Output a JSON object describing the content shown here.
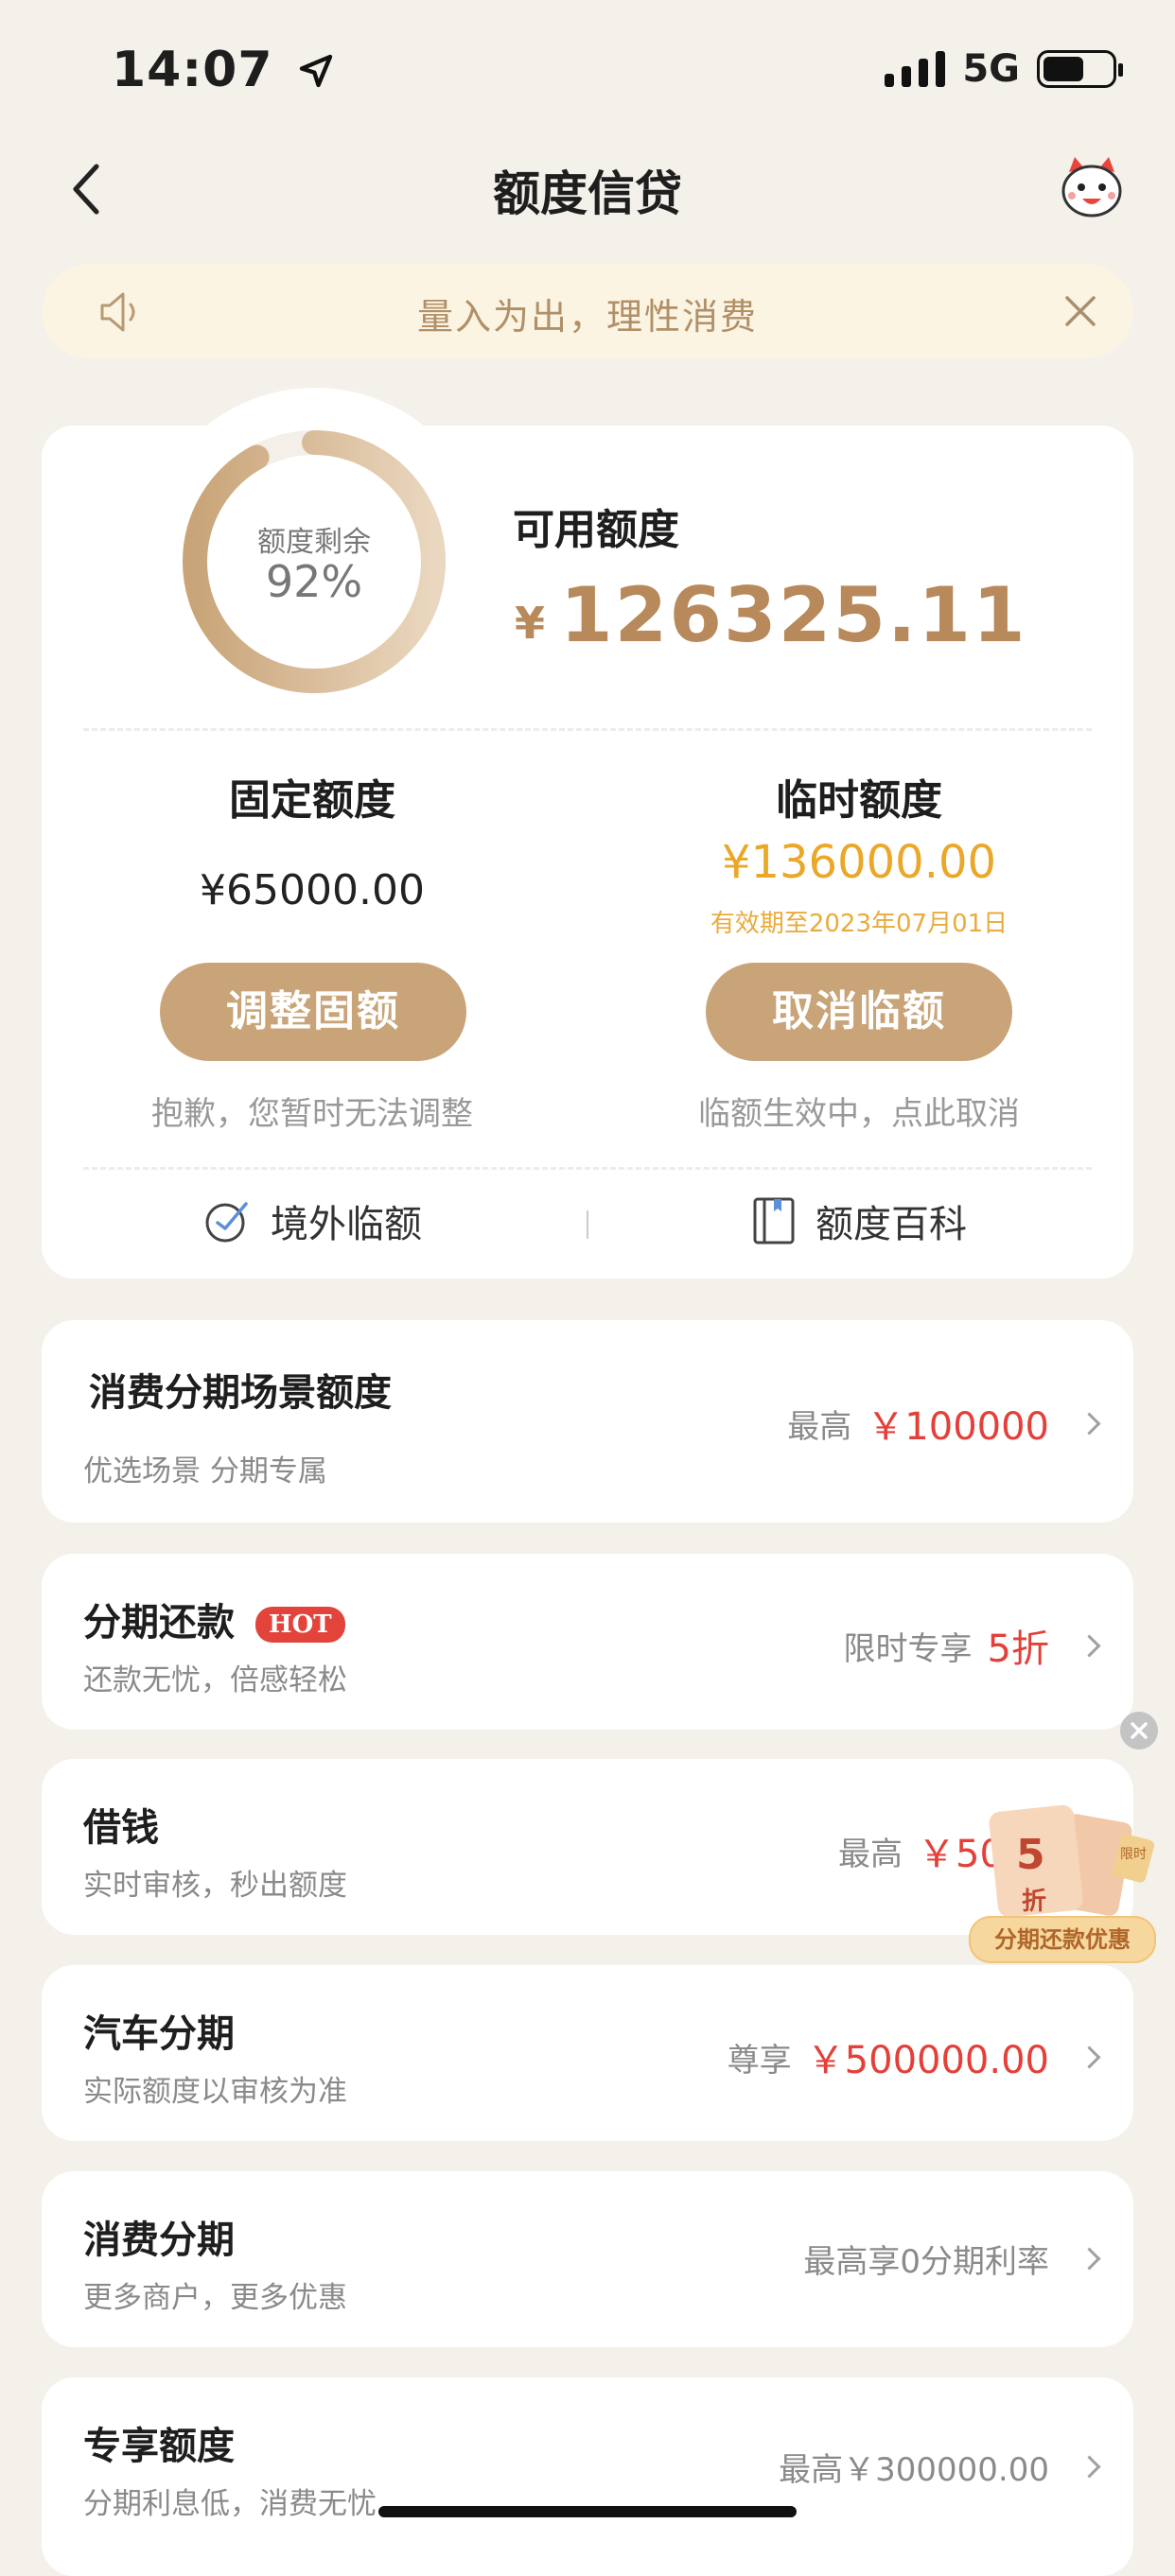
{
  "status_bar": {
    "time": "14:07",
    "network": "5G"
  },
  "nav": {
    "title": "额度信贷"
  },
  "notice": {
    "text": "量入为出，理性消费"
  },
  "credit": {
    "ring_label": "额度剩余",
    "ring_percent": "92%",
    "ring_fraction": 0.92,
    "available_label": "可用额度",
    "available_currency": "¥",
    "available_amount": "126325.11",
    "fixed_title": "固定额度",
    "fixed_amount": "¥65000.00",
    "temp_title": "临时额度",
    "temp_amount": "¥136000.00",
    "temp_valid": "有效期至2023年07月01日",
    "adjust_button": "调整固额",
    "adjust_note": "抱歉，您暂时无法调整",
    "cancel_button": "取消临额",
    "cancel_note": "临额生效中，点此取消",
    "overseas_label": "境外临额",
    "wiki_label": "额度百科"
  },
  "rows": [
    {
      "title": "消费分期场景额度",
      "subtitle": "优选场景 分期专属",
      "prefix": "最高",
      "value": "￥100000"
    },
    {
      "title": "分期还款",
      "badge": "HOT",
      "subtitle": "还款无忧，倍感轻松",
      "prefix": "限时专享",
      "value": "5折"
    },
    {
      "title": "借钱",
      "subtitle": "实时审核，秒出额度",
      "prefix": "最高",
      "value": "￥50"
    },
    {
      "title": "汽车分期",
      "subtitle": "实际额度以审核为准",
      "prefix": "尊享",
      "value": "￥500000.00"
    },
    {
      "title": "消费分期",
      "subtitle": "更多商户，更多优惠",
      "prefix": "最高享0分期利率",
      "value": ""
    },
    {
      "title": "专享额度",
      "subtitle": "分期利息低，消费无忧",
      "prefix": "最高￥300000.00",
      "value": ""
    }
  ],
  "promo": {
    "number": "5",
    "unit": "折",
    "small": "限时",
    "tag": "分期还款优惠"
  },
  "colors": {
    "accent": "#c9a478",
    "gold_text": "#b8895a",
    "temp_orange": "#eaa728",
    "red": "#e3403a",
    "background": "#f4f0ea"
  }
}
